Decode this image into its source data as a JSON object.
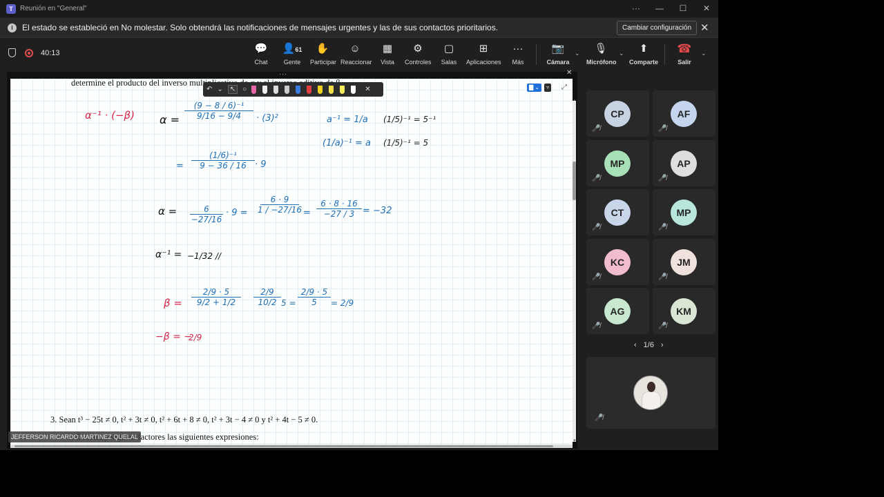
{
  "window": {
    "title": "Reunión en \"General\"",
    "controls": [
      "···",
      "—",
      "☐",
      "✕"
    ]
  },
  "notification": {
    "message": "El estado se estableció en No molestar. Solo obtendrá las notificaciones de mensajes urgentes y las de sus contactos prioritarios.",
    "button": "Cambiar configuración"
  },
  "toolbar": {
    "timer": "40:13",
    "people_count": "61",
    "items": {
      "chat": "Chat",
      "gente": "Gente",
      "participar": "Participar",
      "reaccionar": "Reaccionar",
      "vista": "Vista",
      "controles": "Controles",
      "salas": "Salas",
      "aplicaciones": "Aplicaciones",
      "mas": "Más",
      "camara": "Cámara",
      "microfono": "Micrófono",
      "compartir": "Comparte",
      "salir": "Salir"
    }
  },
  "document": {
    "top_line": "determine el producto del inverso multiplicativo de α y el inverso aditivo de β",
    "exercise3_line": "3.  Sean t³ − 25t ≠ 0, t² + 3t ≠ 0, t² + 6t + 8 ≠ 0, t² + 3t − 4 ≠ 0 y t² + 4t − 5 ≠ 0.",
    "exercise3_sub": "a) Descomponga en factores las siguientes expresiones:"
  },
  "ink": {
    "alpha_inv_times": "α⁻¹ · (−β)",
    "alpha_label": "α =",
    "f1_num": "(9 − 8 / 6)⁻¹",
    "f1_den": "9/16 − 9/4",
    "f1_tail": "· (3)²",
    "eq2_lead": "=",
    "f2_num": "(1/6)⁻¹",
    "f2_den": "9 − 36 / 16",
    "f2_tail": "· 9",
    "rule1": "a⁻¹ = 1/a",
    "rule2": "(1/a)⁻¹ = a",
    "rule3": "(1/5)⁻¹ = 5⁻¹",
    "rule4": "(1/5)⁻¹ = 5",
    "alpha3_label": "α =",
    "f3_num": "6",
    "f3_den": "−27/16",
    "f3_tail": "· 9 =",
    "f4_num": "6 · 9",
    "f4_den": "1 / −27/16",
    "f4_tail": "=",
    "f5_num": "6 · 8 · 16",
    "f5_den": "−27 / 3",
    "f5_result": "= −32",
    "alpha_inv": "α⁻¹ =",
    "alpha_inv_val": "−1/32 //",
    "beta_label": "β =",
    "b1_num": "2/9 · 5",
    "b1_den": "9/2 + 1/2",
    "b2_num": "2/9",
    "b2_den": "10/2",
    "b2_tail": "5 =",
    "b3_num": "2/9 · 5",
    "b3_den": "5",
    "b3_result": "= 2/9",
    "neg_beta": "−β = −",
    "neg_beta_frac": "2/9"
  },
  "presenter_name": "JEFFERSON RICARDO MARTINEZ QUELAL",
  "participants": [
    {
      "initials": "CP",
      "color": "#c7d3e3"
    },
    {
      "initials": "AF",
      "color": "#c5d5ee"
    },
    {
      "initials": "MP",
      "color": "#a8e0b8"
    },
    {
      "initials": "AP",
      "color": "#dedede"
    },
    {
      "initials": "CT",
      "color": "#c9d6ea"
    },
    {
      "initials": "MP",
      "color": "#b8e6dc"
    },
    {
      "initials": "KC",
      "color": "#f2bcd0"
    },
    {
      "initials": "JM",
      "color": "#efe1db"
    },
    {
      "initials": "AG",
      "color": "#c8e8cf"
    },
    {
      "initials": "KM",
      "color": "#d9e6d4"
    }
  ],
  "pager": {
    "label": "1/6",
    "prev": "‹",
    "next": "›"
  },
  "icons": {
    "mute": "🎤̸",
    "chat": "💬",
    "people": "👤",
    "hand": "✋",
    "react": "☺",
    "view": "▦",
    "controls": "⚙",
    "rooms": "▢",
    "apps": "⊞",
    "more": "···",
    "camera": "📷",
    "mic": "🎙",
    "share": "⬆",
    "hangup": "☎"
  }
}
